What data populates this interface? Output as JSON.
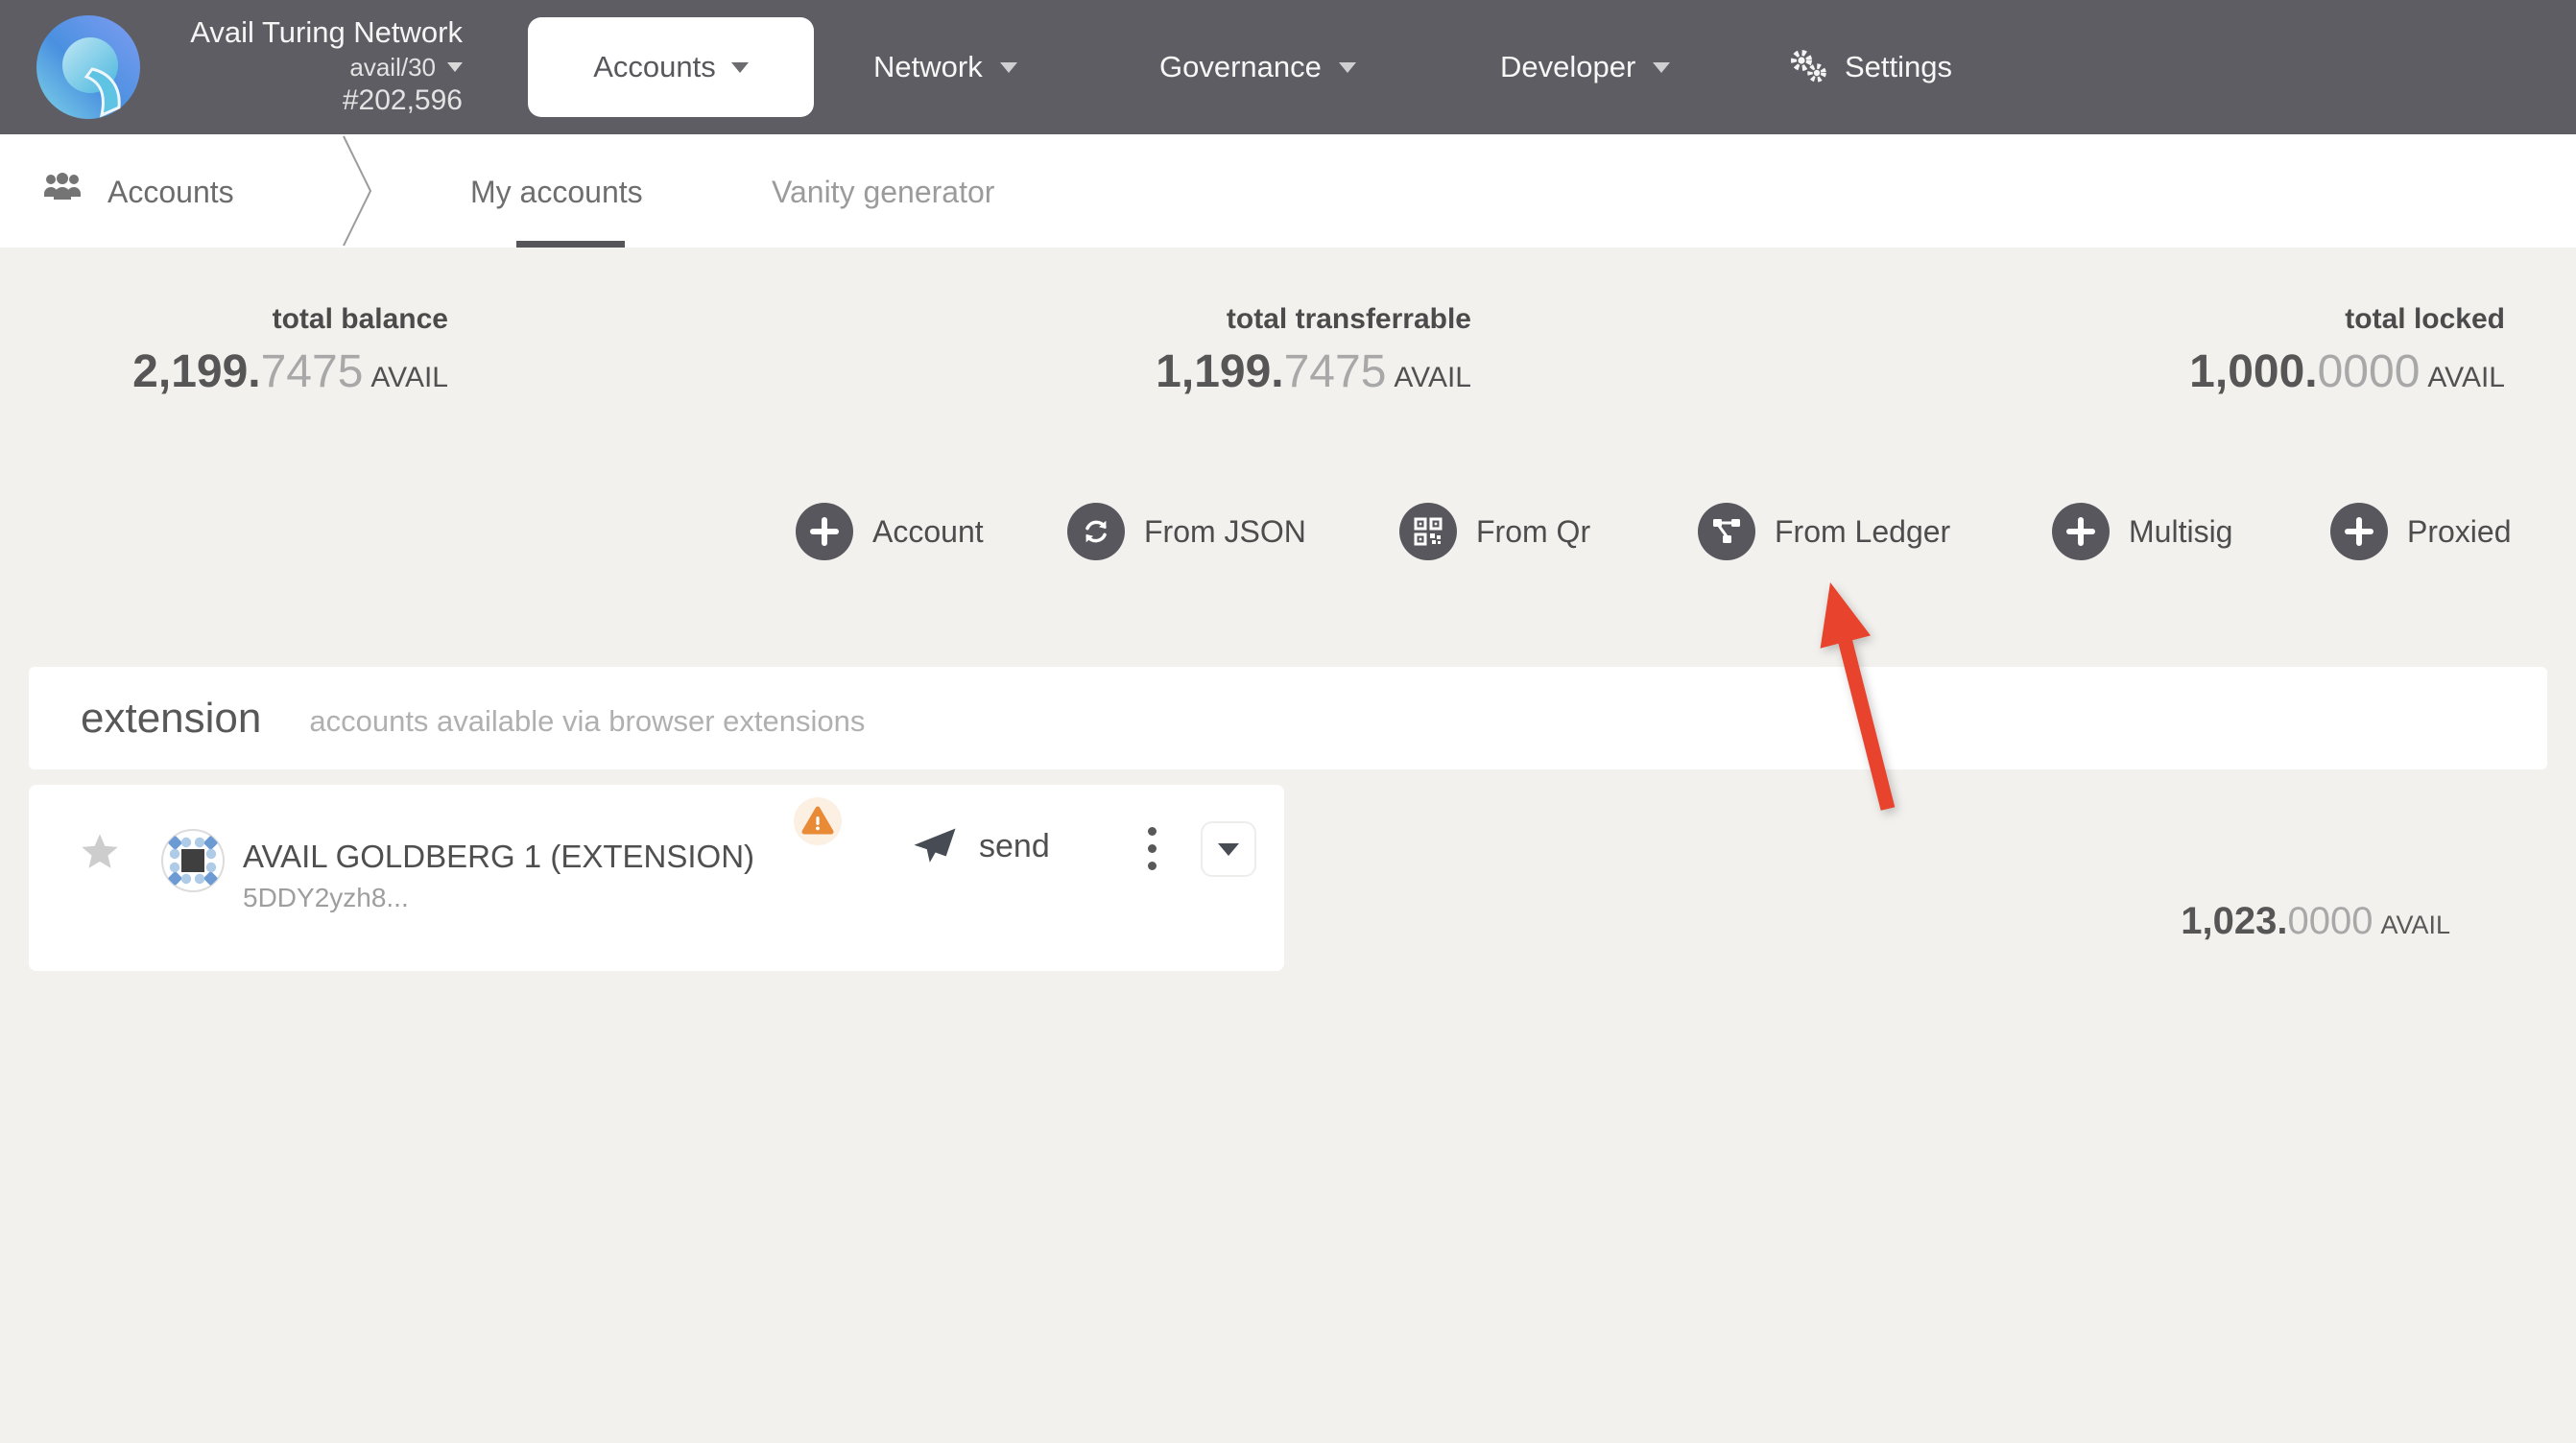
{
  "header": {
    "network_name": "Avail Turing Network",
    "chain_spec": "avail/30",
    "block_number": "#202,596",
    "nav": [
      {
        "label": "Accounts"
      },
      {
        "label": "Network"
      },
      {
        "label": "Governance"
      },
      {
        "label": "Developer"
      },
      {
        "label": "Settings"
      }
    ]
  },
  "subnav": {
    "section": "Accounts",
    "tabs": [
      {
        "label": "My accounts"
      },
      {
        "label": "Vanity generator"
      }
    ]
  },
  "summary": [
    {
      "label": "total balance",
      "int": "2,199.",
      "dec": "7475",
      "unit": "AVAIL"
    },
    {
      "label": "total transferrable",
      "int": "1,199.",
      "dec": "7475",
      "unit": "AVAIL"
    },
    {
      "label": "total locked",
      "int": "1,000.",
      "dec": "0000",
      "unit": "AVAIL"
    }
  ],
  "actions": [
    {
      "label": "Account",
      "icon": "plus-icon"
    },
    {
      "label": "From JSON",
      "icon": "sync-icon"
    },
    {
      "label": "From Qr",
      "icon": "qr-icon"
    },
    {
      "label": "From Ledger",
      "icon": "ledger-icon"
    },
    {
      "label": "Multisig",
      "icon": "plus-icon"
    },
    {
      "label": "Proxied",
      "icon": "plus-icon"
    }
  ],
  "extension_section": {
    "title": "extension",
    "subtitle": "accounts available via browser extensions"
  },
  "account_row": {
    "name": "AVAIL GOLDBERG 1 (EXTENSION)",
    "address": "5DDY2yzh8...",
    "send_label": "send",
    "balance_int": "1,023.",
    "balance_dec": "0000",
    "balance_unit": "AVAIL"
  },
  "colors": {
    "header_bg": "#5e5d63",
    "page_bg": "#f2f1ee",
    "accent_arrow_red": "#e8432c",
    "warning_orange": "#e98a36",
    "button_circle": "#58575d",
    "identicon_blue_dark": "#6c9bd4",
    "identicon_blue_light": "#aecbe8"
  }
}
